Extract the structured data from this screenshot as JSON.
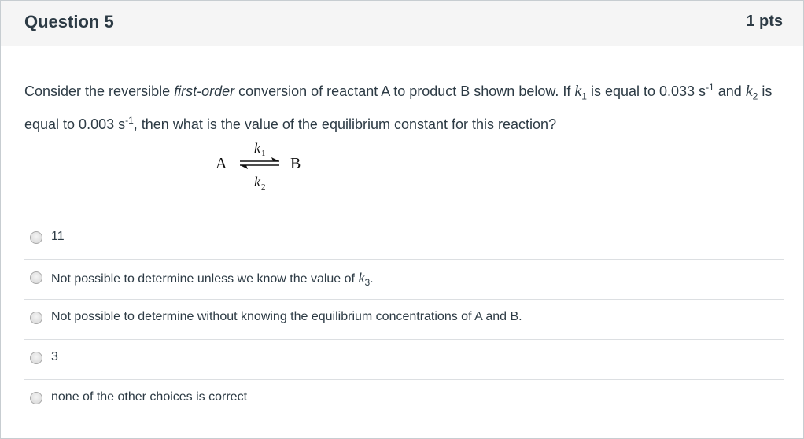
{
  "question": {
    "title": "Question 5",
    "points": "1 pts",
    "text_part1": "Consider the reversible ",
    "text_emphasis": "first-order",
    "text_part2": " conversion of reactant A to product B shown below. If ",
    "k1_symbol": "k",
    "k1_sub": "1",
    "text_part3": " is equal to 0.033 s",
    "sup1": "-1",
    "text_part4": " and ",
    "k2_symbol": "k",
    "k2_sub": "2",
    "text_part5": " is equal to 0.003 s",
    "sup2": "-1",
    "text_part6": ", then what is the value of the equilibrium constant for this reaction?"
  },
  "equation": {
    "reactant": "A",
    "product": "B",
    "forward_rate": "k",
    "forward_sub": "1",
    "reverse_rate": "k",
    "reverse_sub": "2",
    "arrow_icon": "equilibrium-arrows-icon"
  },
  "answers": [
    {
      "label": "11"
    },
    {
      "label_pre": "Not possible to determine unless we know the value of ",
      "k": "k",
      "k_sub": "3",
      "label_post": "."
    },
    {
      "label": "Not possible to determine without knowing the equilibrium concentrations of A and B."
    },
    {
      "label": "3"
    },
    {
      "label": "none of the other choices is correct"
    }
  ]
}
